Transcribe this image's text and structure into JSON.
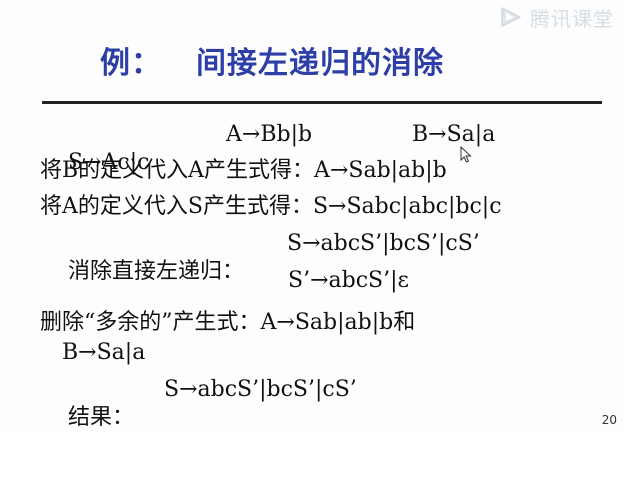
{
  "watermark": {
    "text": "腾讯课堂",
    "icon": "play-icon"
  },
  "slide": {
    "title_prefix": "例：",
    "title_main": "间接左递归的消除",
    "grammar": {
      "rule1": "S→Ac|c",
      "rule2": "A→Bb|b",
      "rule3": "B→Sa|a"
    },
    "line2": "将B的定义代入A产生式得：A→Sab|ab|b",
    "line3": "将A的定义代入S产生式得：S→Sabc|abc|bc|c",
    "line4_label": "消除直接左递归：",
    "line4_rhs": "S→abcS’|bcS’|cS’",
    "line5": "S’→abcS’|ε",
    "line6": "删除“多余的”产生式：A→Sab|ab|b和",
    "line7": "B→Sa|a",
    "line8_label": "结果：",
    "line8_rhs": "S→abcS’|bcS’|cS’",
    "page_number": "20"
  }
}
